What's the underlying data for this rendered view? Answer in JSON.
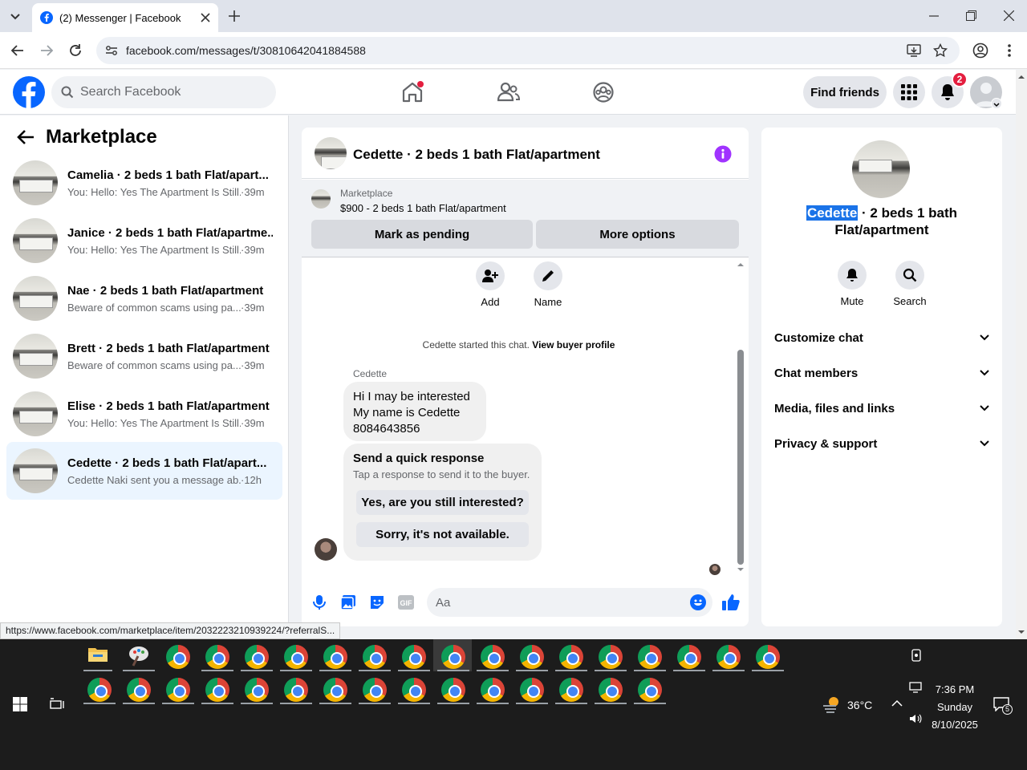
{
  "browser": {
    "tab_title": "(2) Messenger | Facebook",
    "url": "facebook.com/messages/t/30810642041884588",
    "status_url": "https://www.facebook.com/marketplace/item/2032223210939224/?referralS..."
  },
  "header": {
    "search_placeholder": "Search Facebook",
    "find_friends": "Find friends",
    "notification_count": "2"
  },
  "sidebar": {
    "title": "Marketplace",
    "conversations": [
      {
        "name": "Camelia · 2 beds 1 bath Flat/apart...",
        "snippet": "You: Hello: Yes The Apartment Is Still...",
        "time": "·39m"
      },
      {
        "name": "Janice · 2 beds 1 bath Flat/apartme...",
        "snippet": "You: Hello: Yes The Apartment Is Still...",
        "time": "·39m"
      },
      {
        "name": "Nae · 2 beds 1 bath Flat/apartment",
        "snippet": "Beware of common scams using pa...",
        "time": "·39m"
      },
      {
        "name": "Brett · 2 beds 1 bath Flat/apartment",
        "snippet": "Beware of common scams using pa...",
        "time": "·39m"
      },
      {
        "name": "Elise · 2 beds 1 bath Flat/apartment",
        "snippet": "You: Hello: Yes The Apartment Is Still...",
        "time": "·39m"
      },
      {
        "name": "Cedette · 2 beds 1 bath Flat/apart...",
        "snippet": "Cedette Naki sent you a message ab...",
        "time": "·12h"
      }
    ]
  },
  "chat": {
    "title": "Cedette · 2 beds 1 bath Flat/apartment",
    "marketplace_label": "Marketplace",
    "listing": "$900 - 2 beds 1 bath Flat/apartment",
    "mark_pending": "Mark as pending",
    "more_options": "More options",
    "add_label": "Add",
    "name_label": "Name",
    "started_text": "Cedette started this chat.",
    "view_profile": "View buyer profile",
    "sender": "Cedette",
    "message_lines": [
      "Hi I may be interested",
      "My name is Cedette",
      "8084643856"
    ],
    "quick_title": "Send a quick response",
    "quick_sub": "Tap a response to send it to the buyer.",
    "quick_1": "Yes, are you still interested?",
    "quick_2": "Sorry, it's not available.",
    "composer_placeholder": "Aa"
  },
  "info_panel": {
    "name_highlight": "Cedette",
    "name_rest_1": " · 2 beds 1 bath",
    "name_rest_2": "Flat/apartment",
    "mute": "Mute",
    "search": "Search",
    "rows": [
      "Customize chat",
      "Chat members",
      "Media, files and links",
      "Privacy & support"
    ]
  },
  "taskbar": {
    "temperature": "36°C",
    "time": "7:36 PM",
    "day": "Sunday",
    "date": "8/10/2025",
    "notification_count": "5"
  },
  "colors": {
    "fb_blue": "#0866ff",
    "purple_info": "#a033ff",
    "active_conv": "#ebf5ff",
    "selection": "#1a73e8"
  }
}
